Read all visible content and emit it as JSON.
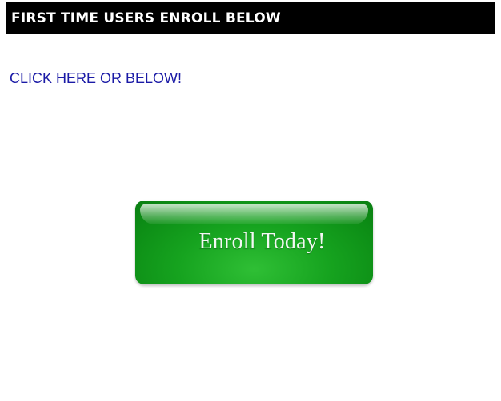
{
  "header": {
    "title": "FIRST TIME USERS ENROLL BELOW"
  },
  "link": {
    "text": "CLICK HERE OR BELOW!"
  },
  "enroll_button": {
    "label": "Enroll Today!"
  },
  "colors": {
    "header_background": "#000000",
    "header_text": "#ffffff",
    "link": "#1a1aa6",
    "button_green": "#16a31f",
    "button_text": "#f4f8f4"
  }
}
